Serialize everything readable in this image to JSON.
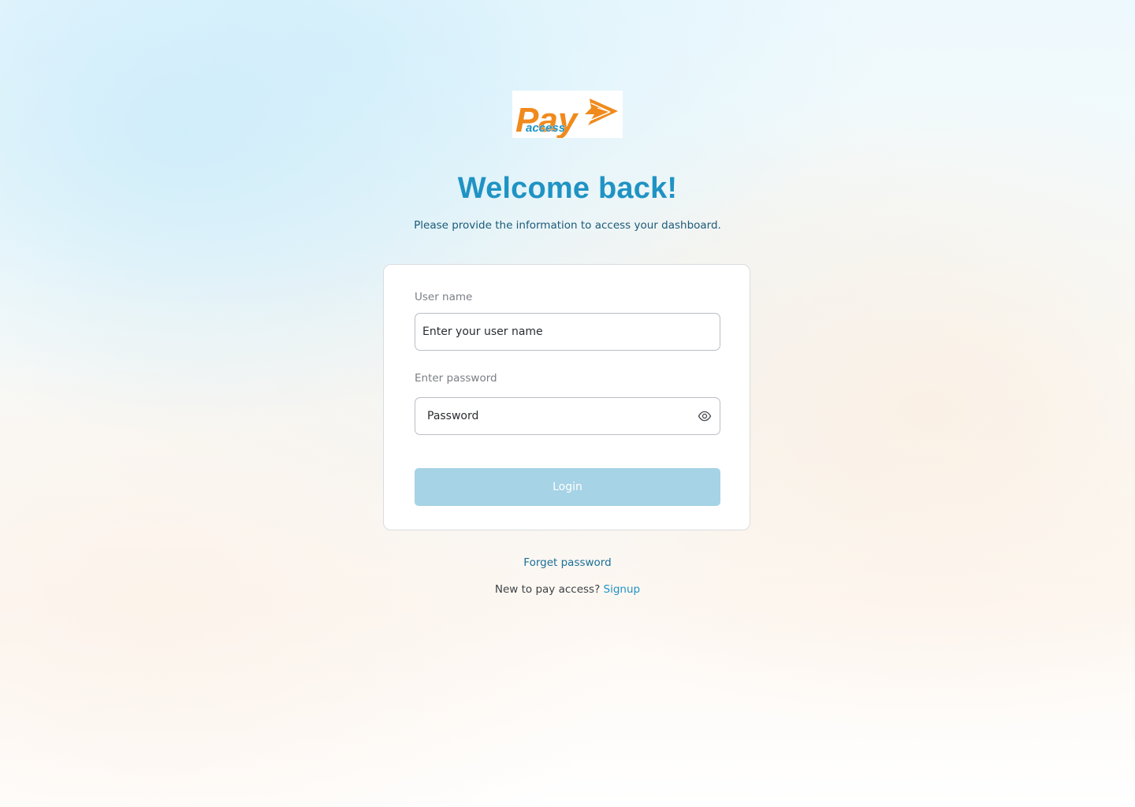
{
  "brand": {
    "logo_main": "Pay",
    "logo_sub": "access",
    "primary_color": "#1f93c4",
    "logo_orange": "#f08a1c"
  },
  "header": {
    "title": "Welcome back!",
    "subtitle": "Please provide the information to access your dashboard."
  },
  "form": {
    "username": {
      "label": "User name",
      "placeholder": "Enter your user name",
      "value": ""
    },
    "password": {
      "label": "Enter password",
      "placeholder": "Password",
      "value": "",
      "toggle_icon": "eye-icon"
    },
    "login_label": "Login",
    "login_color": "#a6d3e6"
  },
  "footer": {
    "forget_label": "Forget password",
    "signup_prompt": "New to pay access?",
    "signup_label": "Signup"
  }
}
